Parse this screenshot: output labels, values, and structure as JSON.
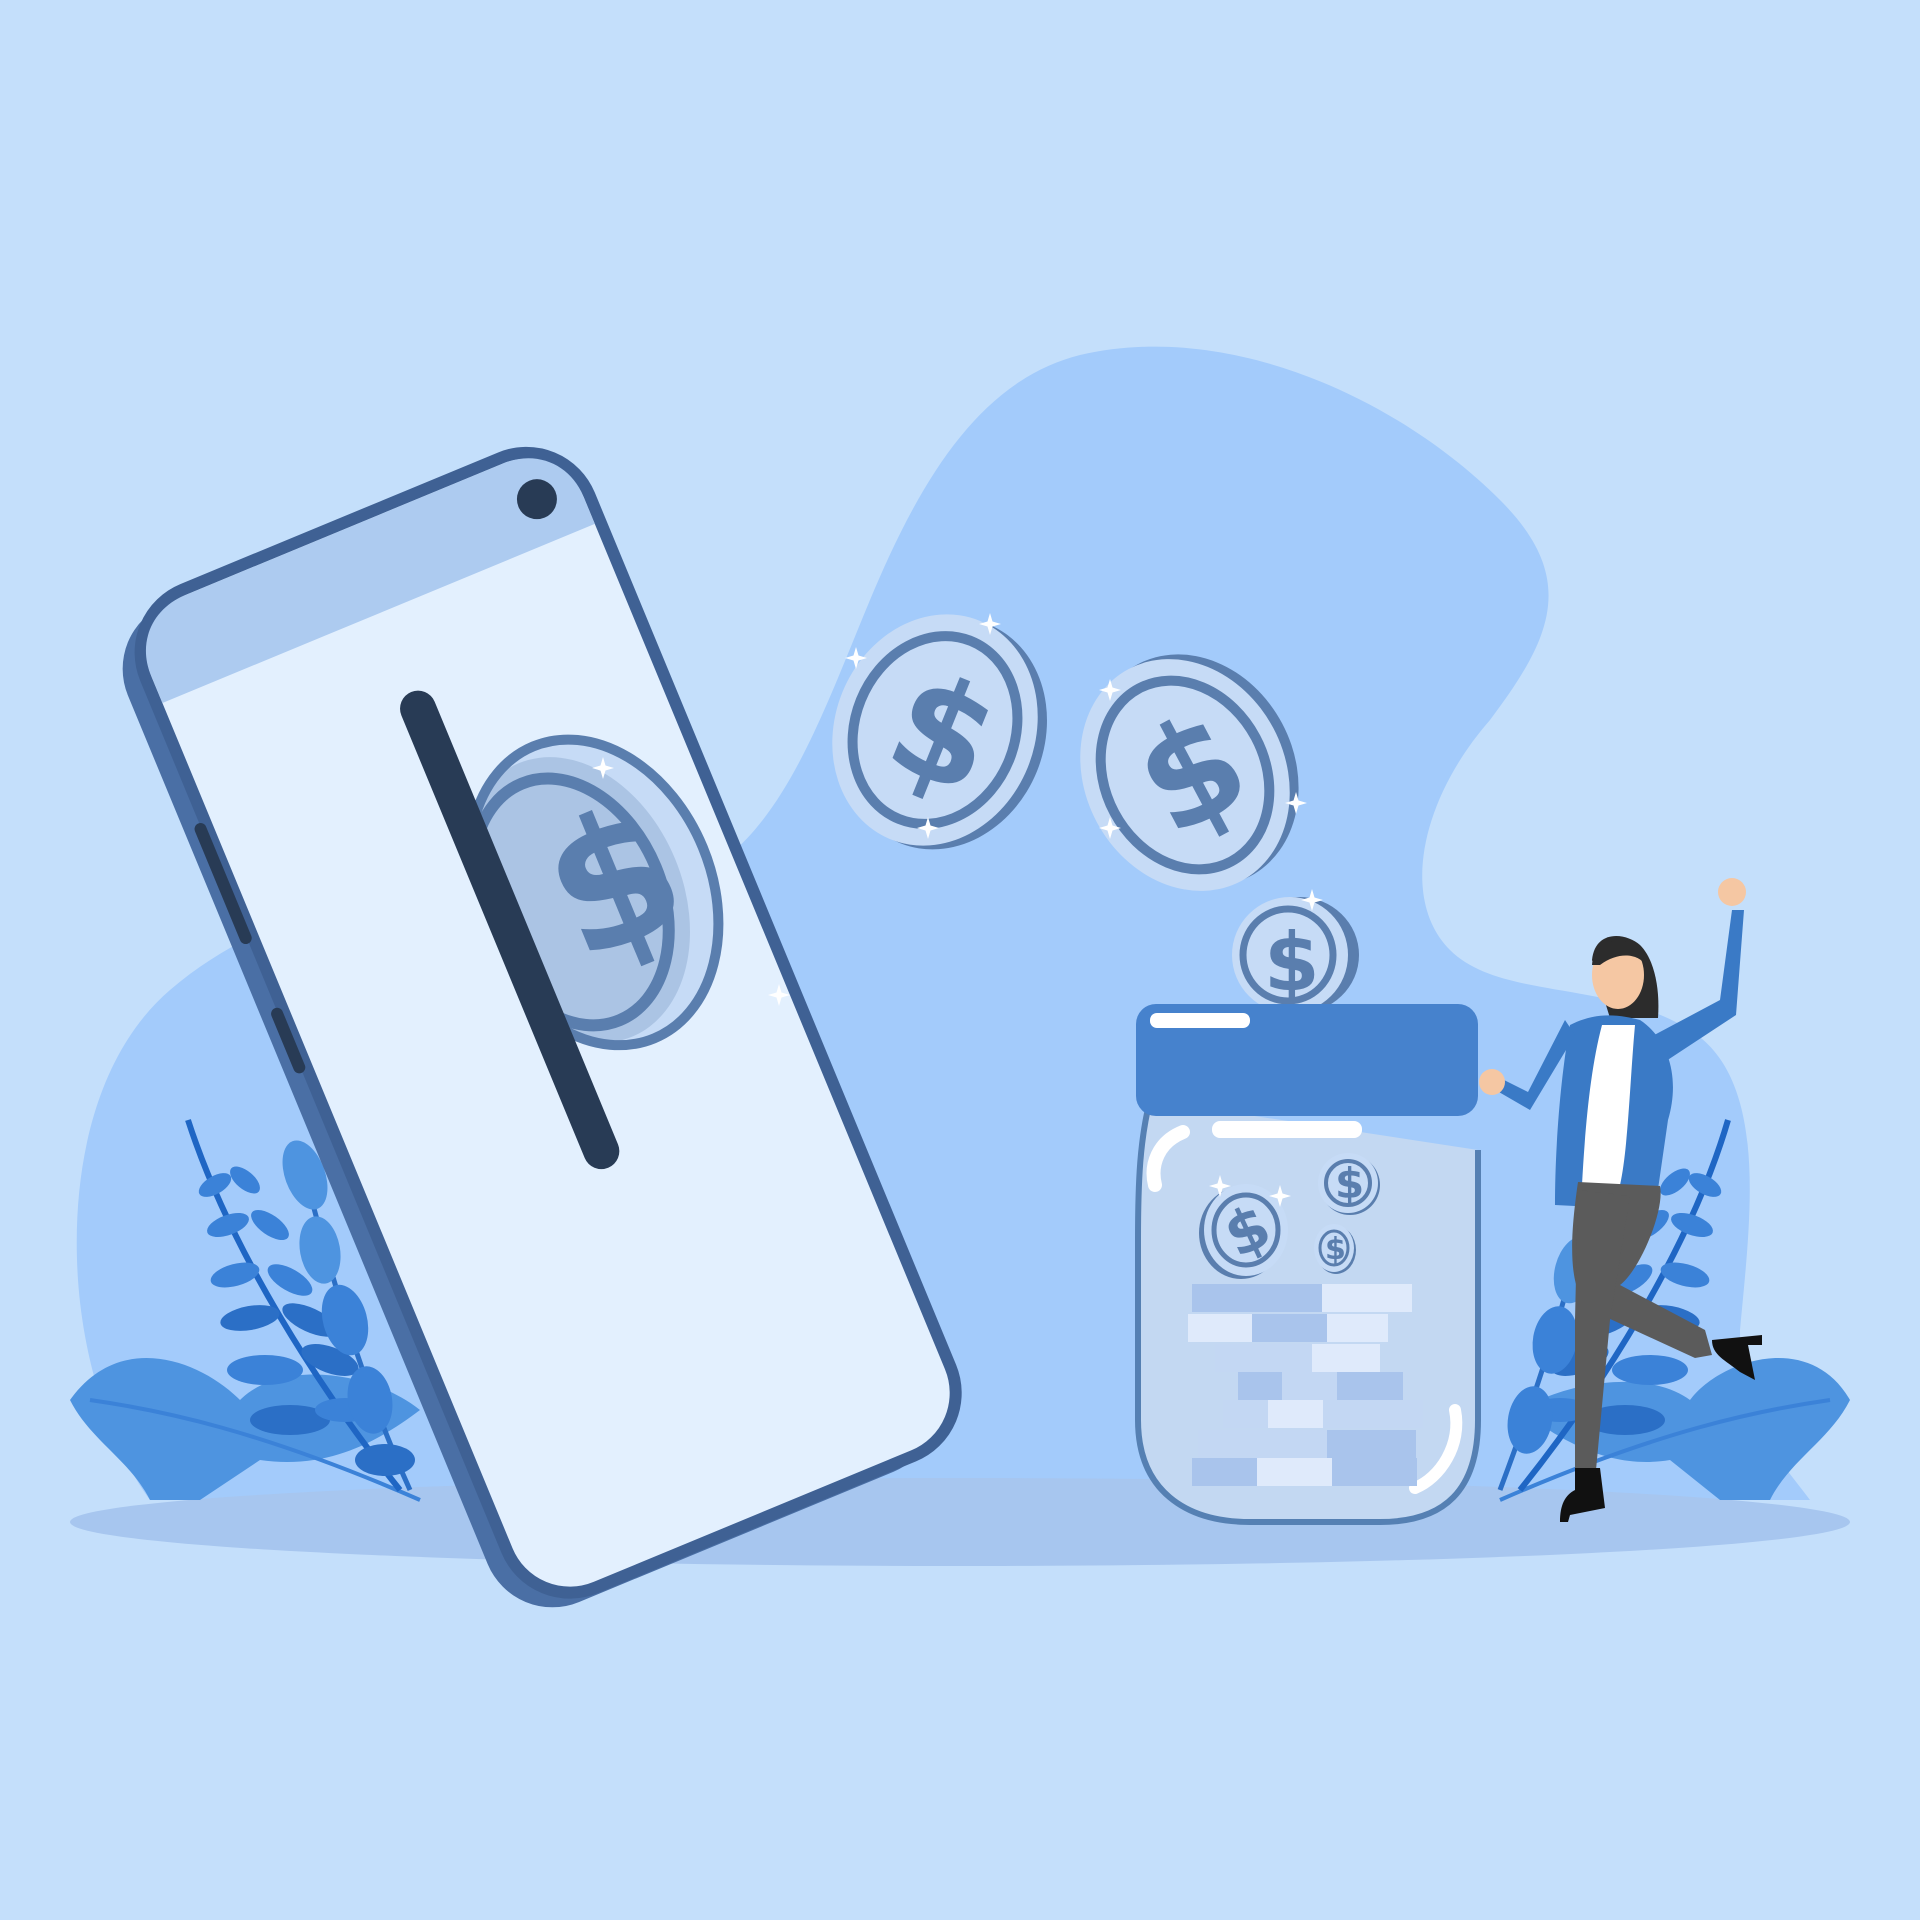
{
  "scene": {
    "background": "#c4dffb",
    "blob_color": "#a3cbfb",
    "ground_color": "#a7c6ef",
    "phone": {
      "body_color": "#4a6fa5",
      "outline_color": "#3f6194",
      "screen_color": "#e3f0fe",
      "header_color": "#adcbf0",
      "slot_color": "#283b55"
    },
    "coins": {
      "fill": "#c6dbf6",
      "ring": "#5a7eae",
      "symbol": "$",
      "sparkle": "#ffffff"
    },
    "jar": {
      "lid_color": "#4682cd",
      "glass_color": "#c3d8f2",
      "outline_color": "#5580b3",
      "highlight": "#ffffff",
      "bill_colors": [
        "#a9c4ec",
        "#dfeafb",
        "#c3d7f3"
      ]
    },
    "leaves": [
      "#4e94e0",
      "#3b82d8",
      "#2b6fc6",
      "#1f66c4"
    ],
    "person": {
      "pose": "cheering",
      "hair_color": "#2c2c2c",
      "skin_color": "#f5c7a3",
      "jacket_color": "#3a7ac6",
      "shirt_color": "#ffffff",
      "pants_color": "#5b5b5b",
      "shoe_color": "#111111"
    }
  }
}
